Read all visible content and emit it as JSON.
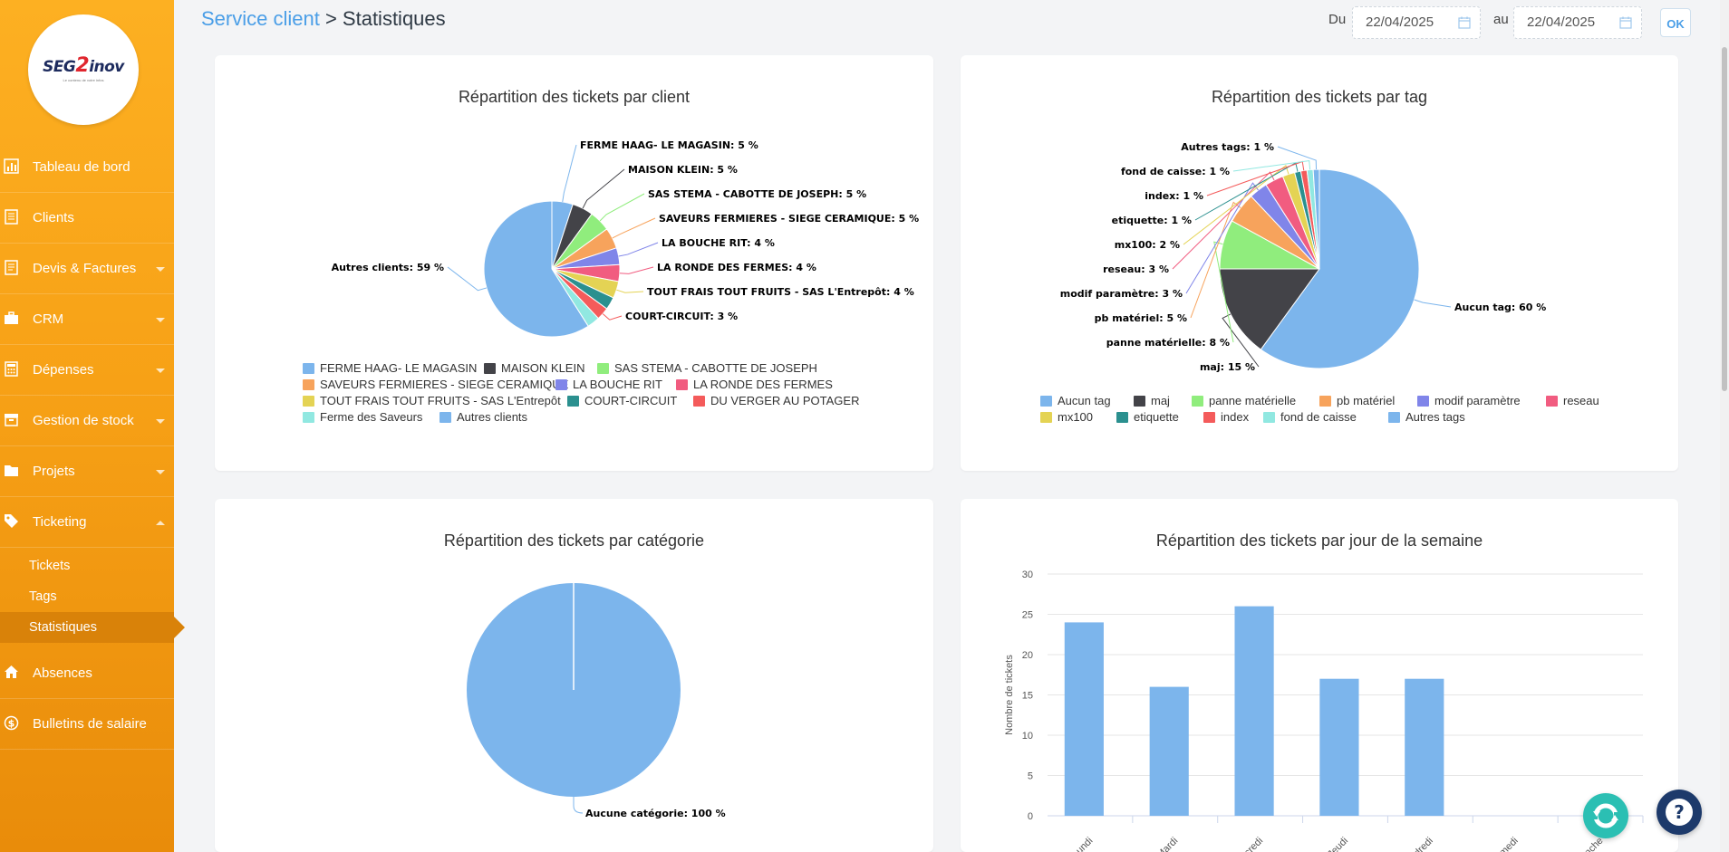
{
  "logo": {
    "brand_a": "SEG",
    "brand_b": "2",
    "brand_c": "inov",
    "tagline": "Le contenu de votre infos"
  },
  "sidebar": {
    "items": [
      {
        "label": "Tableau de bord",
        "icon": "bar-chart-icon",
        "has_submenu": false
      },
      {
        "label": "Clients",
        "icon": "address-book-icon",
        "has_submenu": false
      },
      {
        "label": "Devis & Factures",
        "icon": "document-icon",
        "has_submenu": true
      },
      {
        "label": "CRM",
        "icon": "briefcase-icon",
        "has_submenu": true
      },
      {
        "label": "Dépenses",
        "icon": "calculator-icon",
        "has_submenu": true
      },
      {
        "label": "Gestion de stock",
        "icon": "box-icon",
        "has_submenu": true
      },
      {
        "label": "Projets",
        "icon": "folder-icon",
        "has_submenu": true
      },
      {
        "label": "Ticketing",
        "icon": "tag-icon",
        "has_submenu": true,
        "expanded": true
      },
      {
        "label": "Absences",
        "icon": "home-icon",
        "has_submenu": false
      },
      {
        "label": "Bulletins de salaire",
        "icon": "dollar-icon",
        "has_submenu": false
      }
    ],
    "ticketing_sub": [
      {
        "label": "Tickets",
        "active": false
      },
      {
        "label": "Tags",
        "active": false
      },
      {
        "label": "Statistiques",
        "active": true
      }
    ]
  },
  "header": {
    "breadcrumb_link": "Service client",
    "breadcrumb_sep": " > ",
    "breadcrumb_current": "Statistiques",
    "date_from_label": "Du",
    "date_from": "22/04/2025",
    "date_to_label": "au",
    "date_to": "22/04/2025",
    "ok_label": "OK"
  },
  "chart_data": [
    {
      "type": "pie",
      "title": "Répartition des tickets par client",
      "slices": [
        {
          "name": "FERME HAAG- LE MAGASIN",
          "value": 5,
          "color": "#7cb5ec"
        },
        {
          "name": "MAISON KLEIN",
          "value": 5,
          "color": "#434348"
        },
        {
          "name": "SAS STEMA - CABOTTE DE JOSEPH",
          "value": 5,
          "color": "#90ed7d"
        },
        {
          "name": "SAVEURS FERMIERES - SIEGE CERAMIQUE",
          "value": 5,
          "color": "#f7a35c"
        },
        {
          "name": "LA BOUCHE RIT",
          "value": 4,
          "color": "#8085e9"
        },
        {
          "name": "LA RONDE DES FERMES",
          "value": 4,
          "color": "#f15c80"
        },
        {
          "name": "TOUT FRAIS TOUT FRUITS - SAS L'Entrepôt",
          "value": 4,
          "color": "#e4d354"
        },
        {
          "name": "COURT-CIRCUIT",
          "value": 3,
          "color": "#2b908f"
        },
        {
          "name": "DU VERGER AU POTAGER",
          "value": 3,
          "color": "#f45b5b"
        },
        {
          "name": "Ferme des Saveurs",
          "value": 3,
          "color": "#91e8e1"
        },
        {
          "name": "Autres clients",
          "value": 59,
          "color": "#7cb5ec"
        }
      ],
      "data_labels": [
        "FERME HAAG- LE MAGASIN: 5 %",
        "MAISON KLEIN: 5 %",
        "SAS STEMA - CABOTTE DE JOSEPH: 5 %",
        "SAVEURS FERMIERES - SIEGE CERAMIQUE: 5 %",
        "LA BOUCHE RIT: 4 %",
        "LA RONDE DES FERMES: 4 %",
        "TOUT FRAIS TOUT FRUITS - SAS L'Entrepôt: 4 %",
        "COURT-CIRCUIT: 3 %",
        "Autres clients: 59 %"
      ],
      "legend_position": "bottom"
    },
    {
      "type": "pie",
      "title": "Répartition des tickets par tag",
      "slices": [
        {
          "name": "Aucun tag",
          "value": 60,
          "color": "#7cb5ec"
        },
        {
          "name": "maj",
          "value": 15,
          "color": "#434348"
        },
        {
          "name": "panne matérielle",
          "value": 8,
          "color": "#90ed7d"
        },
        {
          "name": "pb matériel",
          "value": 5,
          "color": "#f7a35c"
        },
        {
          "name": "modif paramètre",
          "value": 3,
          "color": "#8085e9"
        },
        {
          "name": "reseau",
          "value": 3,
          "color": "#f15c80"
        },
        {
          "name": "mx100",
          "value": 2,
          "color": "#e4d354"
        },
        {
          "name": "etiquette",
          "value": 1,
          "color": "#2b908f"
        },
        {
          "name": "index",
          "value": 1,
          "color": "#f45b5b"
        },
        {
          "name": "fond de caisse",
          "value": 1,
          "color": "#91e8e1"
        },
        {
          "name": "Autres tags",
          "value": 1,
          "color": "#7cb5ec"
        }
      ],
      "data_labels": [
        "Aucun tag: 60 %",
        "maj: 15 %",
        "panne matérielle: 8 %",
        "pb matériel: 5 %",
        "modif paramètre: 3 %",
        "reseau: 3 %",
        "mx100: 2 %",
        "etiquette: 1 %",
        "index: 1 %",
        "fond de caisse: 1 %",
        "Autres tags: 1 %"
      ],
      "legend_position": "bottom"
    },
    {
      "type": "pie",
      "title": "Répartition des tickets par catégorie",
      "slices": [
        {
          "name": "Aucune catégorie",
          "value": 100,
          "color": "#7cb5ec"
        }
      ],
      "data_labels": [
        "Aucune catégorie: 100 %"
      ]
    },
    {
      "type": "bar",
      "title": "Répartition des tickets par jour de la semaine",
      "categories": [
        "Lundi",
        "Mardi",
        "Mercredi",
        "Jeudi",
        "Vendredi",
        "Samedi",
        "Dimanche"
      ],
      "values": [
        24,
        16,
        26,
        17,
        17,
        0,
        0
      ],
      "ylabel": "Nombre de tickets",
      "ylim": [
        0,
        30
      ],
      "yticks": [
        0,
        5,
        10,
        15,
        20,
        25,
        30
      ],
      "grid": true,
      "color": "#7cb5ec"
    }
  ]
}
